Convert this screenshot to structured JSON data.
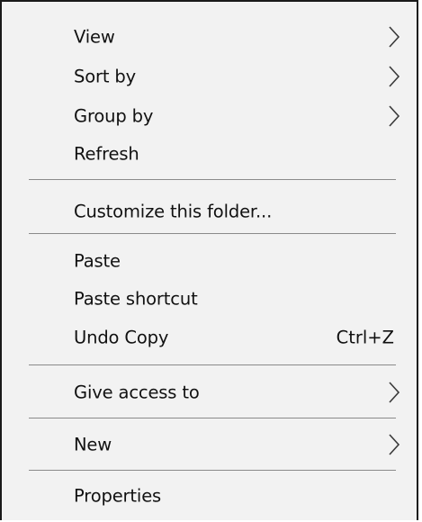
{
  "context_menu": {
    "items": [
      {
        "label": "View",
        "icon": "chevron-right-icon"
      },
      {
        "label": "Sort by",
        "icon": "chevron-right-icon"
      },
      {
        "label": "Group by",
        "icon": "chevron-right-icon"
      },
      {
        "label": "Refresh"
      },
      {
        "label": "Customize this folder..."
      },
      {
        "label": "Paste"
      },
      {
        "label": "Paste shortcut"
      },
      {
        "label": "Undo Copy",
        "shortcut": "Ctrl+Z"
      },
      {
        "label": "Give access to",
        "icon": "chevron-right-icon"
      },
      {
        "label": "New",
        "icon": "chevron-right-icon"
      },
      {
        "label": "Properties"
      }
    ]
  }
}
